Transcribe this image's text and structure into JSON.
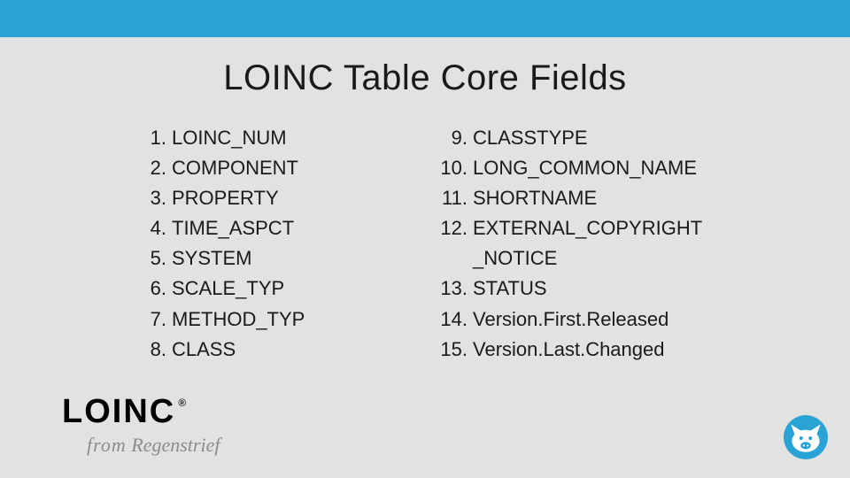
{
  "title": "LOINC Table Core Fields",
  "left": [
    {
      "n": "1.",
      "t": "LOINC_NUM"
    },
    {
      "n": "2.",
      "t": "COMPONENT"
    },
    {
      "n": "3.",
      "t": "PROPERTY"
    },
    {
      "n": "4.",
      "t": "TIME_ASPCT"
    },
    {
      "n": "5.",
      "t": "SYSTEM"
    },
    {
      "n": "6.",
      "t": "SCALE_TYP"
    },
    {
      "n": "7.",
      "t": "METHOD_TYP"
    },
    {
      "n": "8.",
      "t": "CLASS"
    }
  ],
  "right": [
    {
      "n": "9.",
      "t": "CLASSTYPE"
    },
    {
      "n": "10.",
      "t": "LONG_COMMON_NAME"
    },
    {
      "n": "11.",
      "t": "SHORTNAME"
    },
    {
      "n": "12.",
      "t": "EXTERNAL_COPYRIGHT"
    },
    {
      "n": "",
      "t": "_NOTICE",
      "cont": true
    },
    {
      "n": "13.",
      "t": "STATUS"
    },
    {
      "n": "14.",
      "t": "Version.First.Released"
    },
    {
      "n": "15.",
      "t": "Version.Last.Changed"
    }
  ],
  "brand": {
    "name": "LOINC",
    "reg": "®",
    "tagline_from": "from",
    "tagline_org": "Regenstrief"
  }
}
